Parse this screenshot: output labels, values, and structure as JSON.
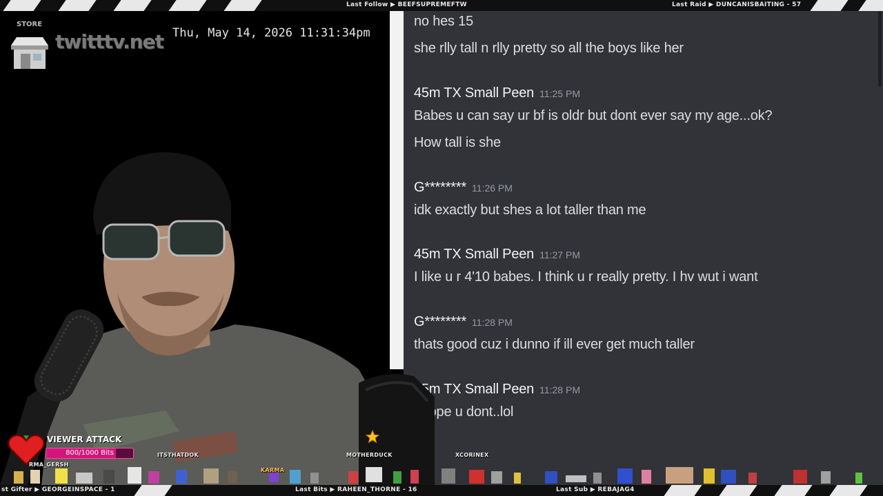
{
  "top_bar": {
    "last_follow": "Last Follow ▶ BEEFSUPREMEFTW",
    "last_raid": "Last Raid ▶ DUNCANISBAITING - 57"
  },
  "bottom_bar": {
    "last_gifter": "st Gifter ▶ GEORGEINSPACE - 1",
    "last_bits": "Last Bits ▶ RAHEEN_THORNE - 16",
    "last_sub": "Last Sub ▶ REBAJAG4"
  },
  "overlay": {
    "clock": "Thu, May 14, 2026 11:31:34pm",
    "store_label": "STORE",
    "site": "twitttv.net",
    "icons": [
      "store-icon",
      "star-icon",
      "heart-icon"
    ]
  },
  "viewer_attack": {
    "title": "VIEWER ATTACK",
    "progress_text": "800/1000 Bits",
    "progress": 0.8,
    "sub_name": "RMA_GERSH"
  },
  "sprite_names": [
    "ITSTHATDOK",
    "KARMA",
    "MOTHERDUCK",
    "XCORINEX"
  ],
  "chat": {
    "messages": [
      {
        "type": "line",
        "text": "no hes 15"
      },
      {
        "type": "line",
        "text": "she rlly tall n rlly pretty so all the boys like her"
      },
      {
        "type": "head",
        "name": "45m TX Small Peen",
        "time": "11:25 PM"
      },
      {
        "type": "line",
        "text": "Babes u can say ur bf is oldr but dont ever say my age...ok?"
      },
      {
        "type": "line",
        "text": "How tall is she"
      },
      {
        "type": "head",
        "name": "G********",
        "time": "11:26 PM"
      },
      {
        "type": "line",
        "text": "idk exactly but shes a lot taller than me"
      },
      {
        "type": "head",
        "name": "45m TX Small Peen",
        "time": "11:27 PM"
      },
      {
        "type": "line",
        "text": "I like u r 4'10 babes. I think u r really pretty. I hv wut i want"
      },
      {
        "type": "head",
        "name": "G********",
        "time": "11:28 PM"
      },
      {
        "type": "line",
        "text": "thats good cuz i dunno if ill ever get much taller"
      },
      {
        "type": "head",
        "name": "45m TX Small Peen",
        "time": "11:28 PM"
      },
      {
        "type": "line",
        "text": "I hope u dont..lol"
      }
    ]
  },
  "colors": {
    "chat_bg": "#313338",
    "accent_pink": "#d4157a",
    "timestamp": "#949ba4"
  }
}
